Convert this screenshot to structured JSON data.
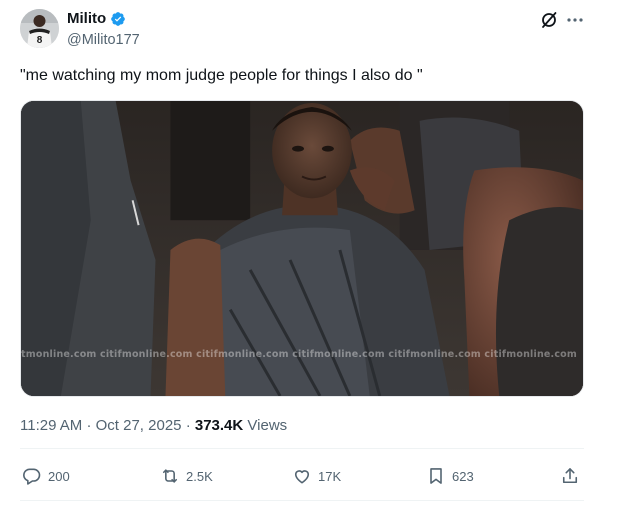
{
  "author": {
    "display_name": "Milito",
    "handle": "@Milito177",
    "verified": true,
    "avatar_jersey_number": "8"
  },
  "tweet": {
    "text": "\"me watching my mom judge people for things I also do \""
  },
  "media": {
    "watermark": "tmonline.com citifmonline.com citifmonline.com citifmonline.com citifmonline.com citifmonline.com"
  },
  "meta": {
    "time": "11:29 AM",
    "separator": "·",
    "date": "Oct 27, 2025",
    "views_count": "373.4K",
    "views_label": "Views"
  },
  "actions": {
    "replies": "200",
    "reposts": "2.5K",
    "likes": "17K",
    "bookmarks": "623"
  },
  "icons": {
    "verified": "verified-badge-icon",
    "grok": "grok-icon",
    "more": "more-icon",
    "reply": "reply-icon",
    "repost": "repost-icon",
    "like": "heart-icon",
    "bookmark": "bookmark-icon",
    "share": "share-icon"
  },
  "colors": {
    "verified": "#1d9bf0",
    "text_primary": "#0f1419",
    "text_secondary": "#536471",
    "divider": "#eff3f4"
  }
}
